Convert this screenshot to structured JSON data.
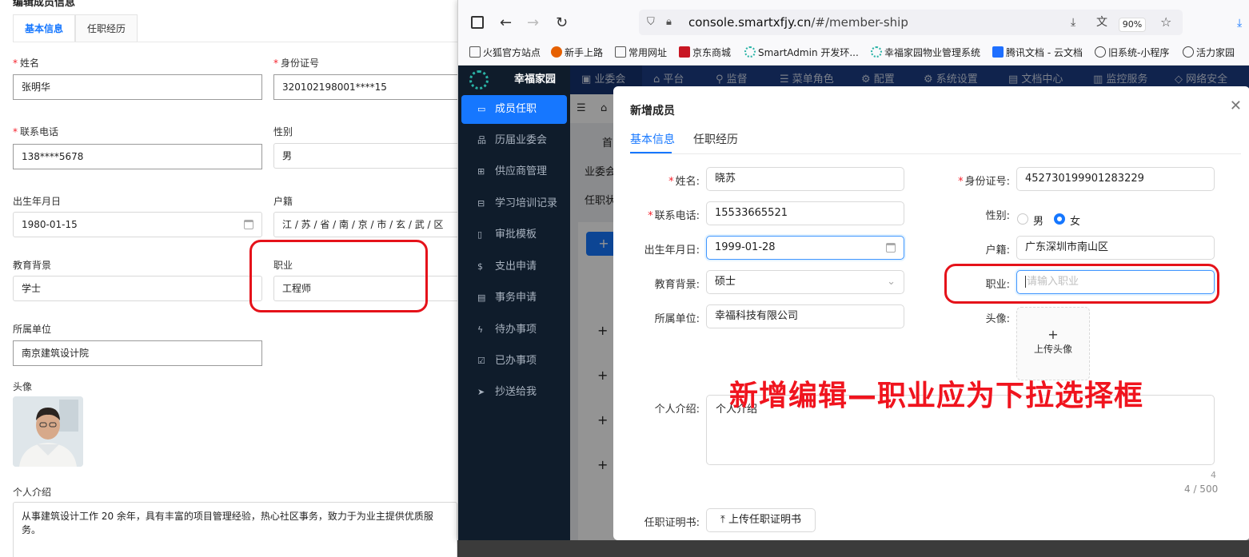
{
  "left": {
    "title": "编辑成员信息",
    "tabs": [
      "基本信息",
      "任职经历"
    ],
    "name_label": "姓名",
    "name_value": "张明华",
    "id_label": "身份证号",
    "id_value": "320102198001****15",
    "phone_label": "联系电话",
    "phone_value": "138****5678",
    "gender_label": "性别",
    "gender_value": "男",
    "birth_label": "出生年月日",
    "birth_value": "1980-01-15",
    "hukou_label": "户籍",
    "hukou_value": "江 / 苏 / 省 / 南 / 京 / 市 / 玄 / 武 / 区",
    "edu_label": "教育背景",
    "edu_value": "学士",
    "job_label": "职业",
    "job_value": "工程师",
    "org_label": "所属单位",
    "org_value": "南京建筑设计院",
    "avatar_label": "头像",
    "intro_label": "个人介绍",
    "intro_value": "从事建筑设计工作 20 余年，具有丰富的项目管理经验，热心社区事务，致力于为业主提供优质服务。"
  },
  "browser": {
    "url_host": "console.smartxfjy.cn",
    "url_path": "/#/member-ship",
    "zoom": "90%",
    "bookmarks": [
      "火狐官方站点",
      "新手上路",
      "常用网址",
      "京东商城",
      "SmartAdmin 开发环...",
      "幸福家园物业管理系统",
      "腾讯文档 - 云文档",
      "旧系统-小程序",
      "活力家园"
    ]
  },
  "app": {
    "brand": "幸福家园",
    "side_items": [
      "成员任职",
      "历届业委会",
      "供应商管理",
      "学习培训记录",
      "审批模板",
      "支出申请",
      "事务申请",
      "待办事项",
      "已办事项",
      "抄送给我"
    ],
    "top_nav": [
      "业委会",
      "平台",
      "监督",
      "菜单角色",
      "配置",
      "系统设置",
      "文档中心",
      "监控服务",
      "网络安全"
    ],
    "crumb": "首",
    "frag1": "业委会",
    "frag2": "任职状"
  },
  "modal": {
    "title": "新增成员",
    "tabs": [
      "基本信息",
      "任职经历"
    ],
    "name_label": "姓名:",
    "name_value": "晓苏",
    "id_label": "身份证号:",
    "id_value": "452730199901283229",
    "phone_label": "联系电话:",
    "phone_value": "15533665521",
    "gender_label": "性别:",
    "gender_male": "男",
    "gender_female": "女",
    "birth_label": "出生年月日:",
    "birth_value": "1999-01-28",
    "hukou_label": "户籍:",
    "hukou_value": "广东深圳市南山区",
    "edu_label": "教育背景:",
    "edu_value": "硕士",
    "job_label": "职业:",
    "job_placeholder": "请输入职业",
    "org_label": "所属单位:",
    "org_value": "幸福科技有限公司",
    "avatar_label": "头像:",
    "upload_label": "上传头像",
    "intro_label": "个人介绍:",
    "intro_value": "个人介绍",
    "count_small": "4",
    "count": "4 / 500",
    "cert_label": "任职证明书:",
    "cert_button": "上传任职证明书"
  },
  "annotation": "新增编辑—职业应为下拉选择框",
  "colors": {
    "accent": "#1677ff",
    "annotation": "#e5121a",
    "sidebar": "#0f1c2b",
    "topbar": "#1c3d86"
  }
}
